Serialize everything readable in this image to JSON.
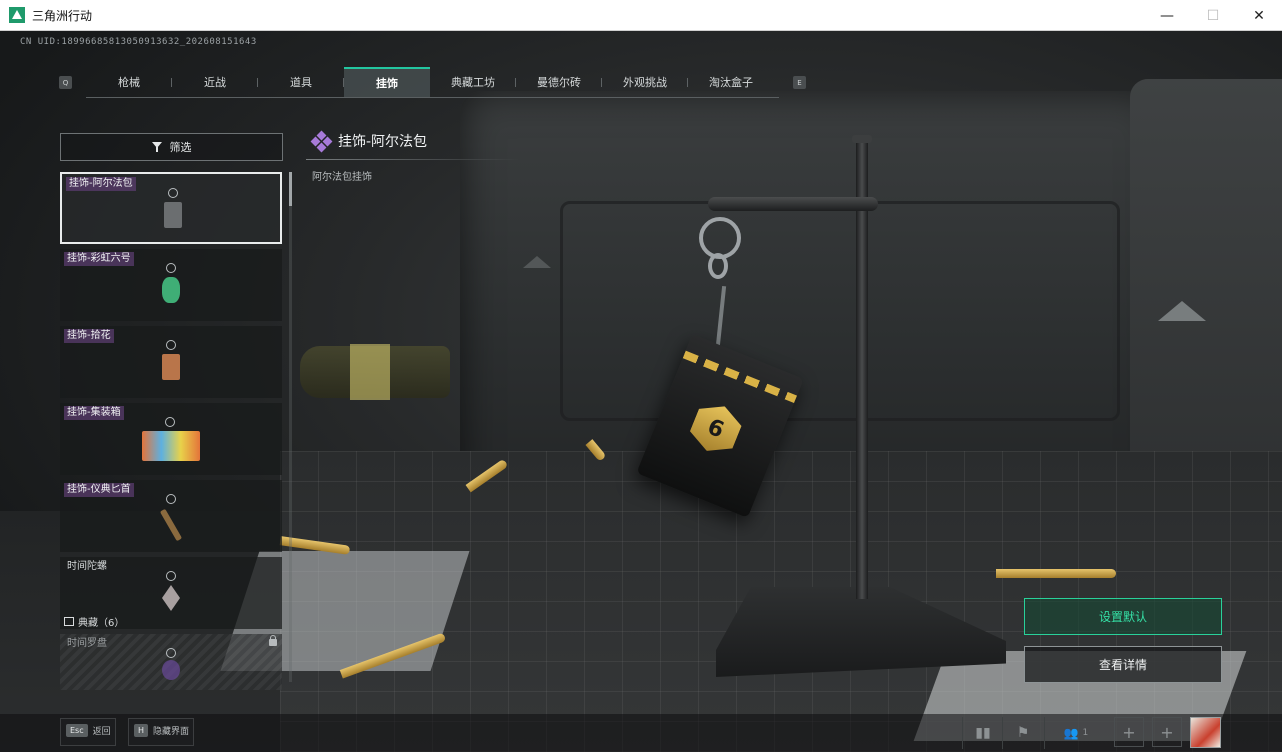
{
  "window": {
    "title": "三角洲行动",
    "minimize": "—",
    "maximize": "☐",
    "close": "✕"
  },
  "uid": "CN UID:18996685813050913632_202608151643",
  "tabs": {
    "key_prev": "Q",
    "key_next": "E",
    "items": [
      {
        "label": "枪械",
        "active": false
      },
      {
        "label": "近战",
        "active": false
      },
      {
        "label": "道具",
        "active": false
      },
      {
        "label": "挂饰",
        "active": true
      },
      {
        "label": "典藏工坊",
        "active": false
      },
      {
        "label": "曼德尔砖",
        "active": false
      },
      {
        "label": "外观挑战",
        "active": false
      },
      {
        "label": "淘汰盒子",
        "active": false
      }
    ]
  },
  "sidebar": {
    "filter_label": "筛选",
    "items": [
      {
        "label": "挂饰-阿尔法包",
        "selected": true,
        "color": "#6b6e70"
      },
      {
        "label": "挂饰-彩虹六号",
        "selected": false,
        "color": "#3fae76"
      },
      {
        "label": "挂饰-拾花",
        "selected": false,
        "color": "#b9754a"
      },
      {
        "label": "挂饰-集装箱",
        "selected": false,
        "color": "#e4743a"
      },
      {
        "label": "挂饰-仪典匕首",
        "selected": false,
        "color": "#8a6a3e"
      },
      {
        "label": "时间陀螺",
        "selected": false,
        "color": "#a8a0a0"
      },
      {
        "label": "时间罗盘",
        "selected": false,
        "locked": true,
        "color": "#6a4a9a"
      }
    ],
    "collection_label": "典藏（6）"
  },
  "detail": {
    "title": "挂饰-阿尔法包",
    "description": "阿尔法包挂饰",
    "badge_glyph": "6"
  },
  "actions": {
    "set_default": "设置默认",
    "view_details": "查看详情"
  },
  "bottom": {
    "back_key": "Esc",
    "back_label": "返回",
    "hide_key": "H",
    "hide_label": "隐藏界面",
    "squad_count": "1",
    "plus": "+"
  }
}
